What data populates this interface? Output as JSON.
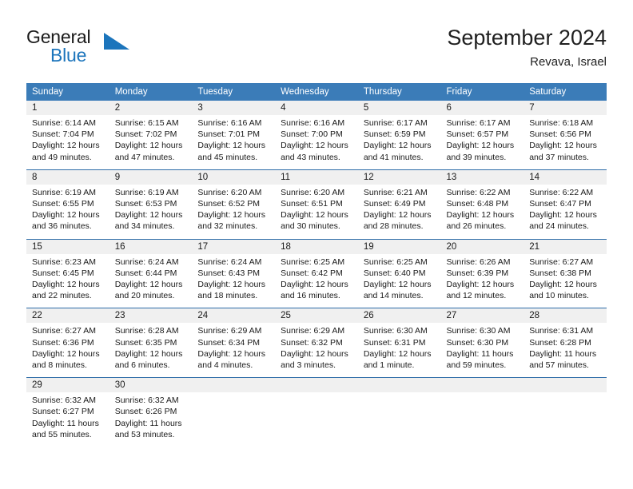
{
  "brand": {
    "name_part1": "General",
    "name_part2": "Blue",
    "logo_icon": "triangle-logo-icon"
  },
  "header": {
    "title": "September 2024",
    "subtitle": "Revava, Israel"
  },
  "calendar": {
    "weekday_headers": [
      "Sunday",
      "Monday",
      "Tuesday",
      "Wednesday",
      "Thursday",
      "Friday",
      "Saturday"
    ],
    "accent_color": "#3b7cb8",
    "header_border_color": "#2d6ca8",
    "daynum_band_color": "#f0f0f0",
    "weeks": [
      [
        null,
        null,
        null,
        null,
        null,
        null,
        null
      ]
    ],
    "days": [
      {
        "day": "1",
        "col": 0,
        "week": 0,
        "sunrise": "Sunrise: 6:14 AM",
        "sunset": "Sunset: 7:04 PM",
        "daylight_line1": "Daylight: 12 hours",
        "daylight_line2": "and 49 minutes."
      },
      {
        "day": "2",
        "col": 1,
        "week": 0,
        "sunrise": "Sunrise: 6:15 AM",
        "sunset": "Sunset: 7:02 PM",
        "daylight_line1": "Daylight: 12 hours",
        "daylight_line2": "and 47 minutes."
      },
      {
        "day": "3",
        "col": 2,
        "week": 0,
        "sunrise": "Sunrise: 6:16 AM",
        "sunset": "Sunset: 7:01 PM",
        "daylight_line1": "Daylight: 12 hours",
        "daylight_line2": "and 45 minutes."
      },
      {
        "day": "4",
        "col": 3,
        "week": 0,
        "sunrise": "Sunrise: 6:16 AM",
        "sunset": "Sunset: 7:00 PM",
        "daylight_line1": "Daylight: 12 hours",
        "daylight_line2": "and 43 minutes."
      },
      {
        "day": "5",
        "col": 4,
        "week": 0,
        "sunrise": "Sunrise: 6:17 AM",
        "sunset": "Sunset: 6:59 PM",
        "daylight_line1": "Daylight: 12 hours",
        "daylight_line2": "and 41 minutes."
      },
      {
        "day": "6",
        "col": 5,
        "week": 0,
        "sunrise": "Sunrise: 6:17 AM",
        "sunset": "Sunset: 6:57 PM",
        "daylight_line1": "Daylight: 12 hours",
        "daylight_line2": "and 39 minutes."
      },
      {
        "day": "7",
        "col": 6,
        "week": 0,
        "sunrise": "Sunrise: 6:18 AM",
        "sunset": "Sunset: 6:56 PM",
        "daylight_line1": "Daylight: 12 hours",
        "daylight_line2": "and 37 minutes."
      },
      {
        "day": "8",
        "col": 0,
        "week": 1,
        "sunrise": "Sunrise: 6:19 AM",
        "sunset": "Sunset: 6:55 PM",
        "daylight_line1": "Daylight: 12 hours",
        "daylight_line2": "and 36 minutes."
      },
      {
        "day": "9",
        "col": 1,
        "week": 1,
        "sunrise": "Sunrise: 6:19 AM",
        "sunset": "Sunset: 6:53 PM",
        "daylight_line1": "Daylight: 12 hours",
        "daylight_line2": "and 34 minutes."
      },
      {
        "day": "10",
        "col": 2,
        "week": 1,
        "sunrise": "Sunrise: 6:20 AM",
        "sunset": "Sunset: 6:52 PM",
        "daylight_line1": "Daylight: 12 hours",
        "daylight_line2": "and 32 minutes."
      },
      {
        "day": "11",
        "col": 3,
        "week": 1,
        "sunrise": "Sunrise: 6:20 AM",
        "sunset": "Sunset: 6:51 PM",
        "daylight_line1": "Daylight: 12 hours",
        "daylight_line2": "and 30 minutes."
      },
      {
        "day": "12",
        "col": 4,
        "week": 1,
        "sunrise": "Sunrise: 6:21 AM",
        "sunset": "Sunset: 6:49 PM",
        "daylight_line1": "Daylight: 12 hours",
        "daylight_line2": "and 28 minutes."
      },
      {
        "day": "13",
        "col": 5,
        "week": 1,
        "sunrise": "Sunrise: 6:22 AM",
        "sunset": "Sunset: 6:48 PM",
        "daylight_line1": "Daylight: 12 hours",
        "daylight_line2": "and 26 minutes."
      },
      {
        "day": "14",
        "col": 6,
        "week": 1,
        "sunrise": "Sunrise: 6:22 AM",
        "sunset": "Sunset: 6:47 PM",
        "daylight_line1": "Daylight: 12 hours",
        "daylight_line2": "and 24 minutes."
      },
      {
        "day": "15",
        "col": 0,
        "week": 2,
        "sunrise": "Sunrise: 6:23 AM",
        "sunset": "Sunset: 6:45 PM",
        "daylight_line1": "Daylight: 12 hours",
        "daylight_line2": "and 22 minutes."
      },
      {
        "day": "16",
        "col": 1,
        "week": 2,
        "sunrise": "Sunrise: 6:24 AM",
        "sunset": "Sunset: 6:44 PM",
        "daylight_line1": "Daylight: 12 hours",
        "daylight_line2": "and 20 minutes."
      },
      {
        "day": "17",
        "col": 2,
        "week": 2,
        "sunrise": "Sunrise: 6:24 AM",
        "sunset": "Sunset: 6:43 PM",
        "daylight_line1": "Daylight: 12 hours",
        "daylight_line2": "and 18 minutes."
      },
      {
        "day": "18",
        "col": 3,
        "week": 2,
        "sunrise": "Sunrise: 6:25 AM",
        "sunset": "Sunset: 6:42 PM",
        "daylight_line1": "Daylight: 12 hours",
        "daylight_line2": "and 16 minutes."
      },
      {
        "day": "19",
        "col": 4,
        "week": 2,
        "sunrise": "Sunrise: 6:25 AM",
        "sunset": "Sunset: 6:40 PM",
        "daylight_line1": "Daylight: 12 hours",
        "daylight_line2": "and 14 minutes."
      },
      {
        "day": "20",
        "col": 5,
        "week": 2,
        "sunrise": "Sunrise: 6:26 AM",
        "sunset": "Sunset: 6:39 PM",
        "daylight_line1": "Daylight: 12 hours",
        "daylight_line2": "and 12 minutes."
      },
      {
        "day": "21",
        "col": 6,
        "week": 2,
        "sunrise": "Sunrise: 6:27 AM",
        "sunset": "Sunset: 6:38 PM",
        "daylight_line1": "Daylight: 12 hours",
        "daylight_line2": "and 10 minutes."
      },
      {
        "day": "22",
        "col": 0,
        "week": 3,
        "sunrise": "Sunrise: 6:27 AM",
        "sunset": "Sunset: 6:36 PM",
        "daylight_line1": "Daylight: 12 hours",
        "daylight_line2": "and 8 minutes."
      },
      {
        "day": "23",
        "col": 1,
        "week": 3,
        "sunrise": "Sunrise: 6:28 AM",
        "sunset": "Sunset: 6:35 PM",
        "daylight_line1": "Daylight: 12 hours",
        "daylight_line2": "and 6 minutes."
      },
      {
        "day": "24",
        "col": 2,
        "week": 3,
        "sunrise": "Sunrise: 6:29 AM",
        "sunset": "Sunset: 6:34 PM",
        "daylight_line1": "Daylight: 12 hours",
        "daylight_line2": "and 4 minutes."
      },
      {
        "day": "25",
        "col": 3,
        "week": 3,
        "sunrise": "Sunrise: 6:29 AM",
        "sunset": "Sunset: 6:32 PM",
        "daylight_line1": "Daylight: 12 hours",
        "daylight_line2": "and 3 minutes."
      },
      {
        "day": "26",
        "col": 4,
        "week": 3,
        "sunrise": "Sunrise: 6:30 AM",
        "sunset": "Sunset: 6:31 PM",
        "daylight_line1": "Daylight: 12 hours",
        "daylight_line2": "and 1 minute."
      },
      {
        "day": "27",
        "col": 5,
        "week": 3,
        "sunrise": "Sunrise: 6:30 AM",
        "sunset": "Sunset: 6:30 PM",
        "daylight_line1": "Daylight: 11 hours",
        "daylight_line2": "and 59 minutes."
      },
      {
        "day": "28",
        "col": 6,
        "week": 3,
        "sunrise": "Sunrise: 6:31 AM",
        "sunset": "Sunset: 6:28 PM",
        "daylight_line1": "Daylight: 11 hours",
        "daylight_line2": "and 57 minutes."
      },
      {
        "day": "29",
        "col": 0,
        "week": 4,
        "sunrise": "Sunrise: 6:32 AM",
        "sunset": "Sunset: 6:27 PM",
        "daylight_line1": "Daylight: 11 hours",
        "daylight_line2": "and 55 minutes."
      },
      {
        "day": "30",
        "col": 1,
        "week": 4,
        "sunrise": "Sunrise: 6:32 AM",
        "sunset": "Sunset: 6:26 PM",
        "daylight_line1": "Daylight: 11 hours",
        "daylight_line2": "and 53 minutes."
      }
    ]
  }
}
